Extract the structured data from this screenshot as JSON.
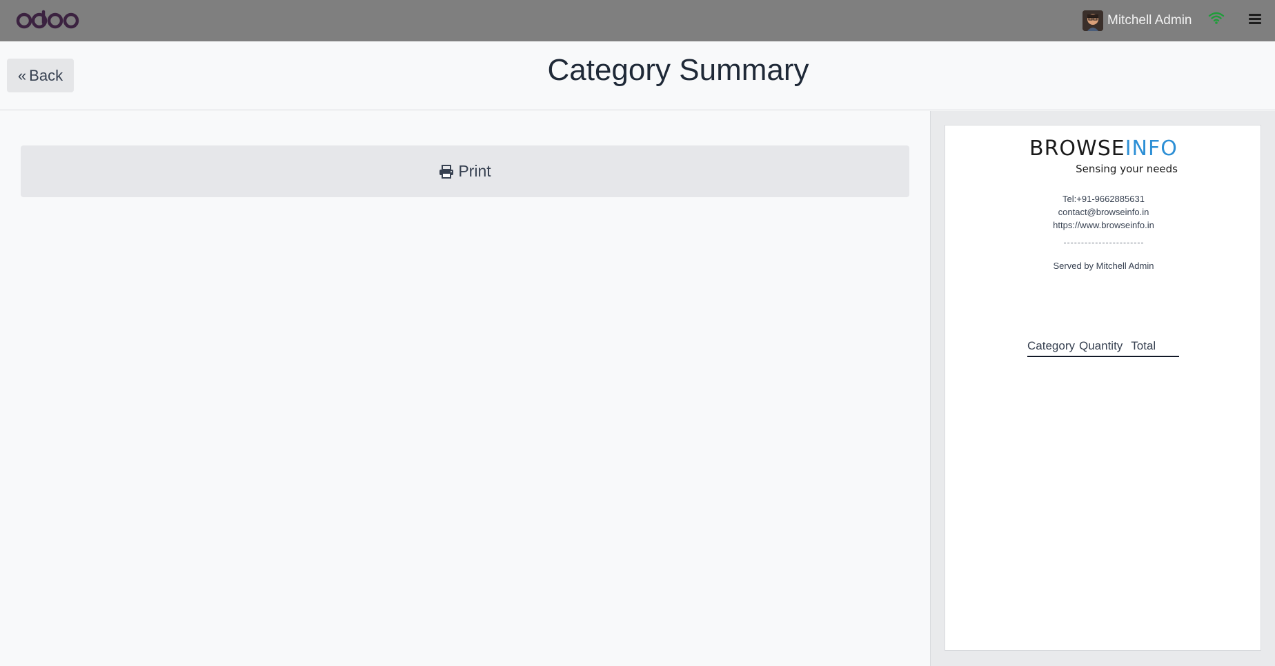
{
  "topbar": {
    "logo_text": "odoo",
    "user_name": "Mitchell Admin",
    "icons": [
      "avatar",
      "wifi-icon",
      "hamburger-menu-icon"
    ],
    "wifi_color": "#1f9d3a"
  },
  "header": {
    "back_label": "Back",
    "title": "Category Summary"
  },
  "main": {
    "print_label": "Print"
  },
  "receipt": {
    "brand_part1": "BROWSE",
    "brand_part2": "INFO",
    "tagline": "Sensing your needs",
    "tel": "Tel:+91-9662885631",
    "email": "contact@browseinfo.in",
    "website": "https://www.browseinfo.in",
    "separator": "--------------------------------",
    "served_by": "Served by Mitchell Admin",
    "columns": [
      "Category",
      "Quantity",
      "Total"
    ]
  },
  "colors": {
    "topbar": "#7f7f7f",
    "brand_blue": "#2d8fd5",
    "logo_purple": "#3b2240"
  }
}
